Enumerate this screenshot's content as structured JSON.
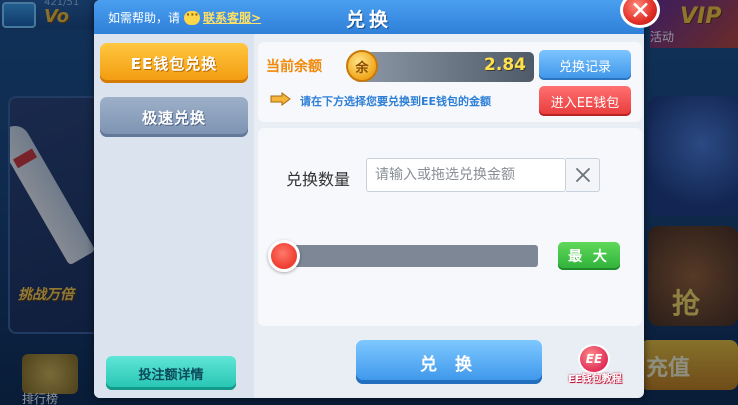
{
  "background": {
    "logo_text": "Vo",
    "user_id": "421/51",
    "left_card_text": "挑战万倍",
    "rank_label": "排行榜",
    "right_top_text": "VIP",
    "activity_label": "活动",
    "right_mid_text": "抢",
    "recharge_label": "充值"
  },
  "dialog": {
    "title": "兑换",
    "help_prefix": "如需帮助，请",
    "help_link": "联系客服>"
  },
  "tabs": [
    {
      "label": "EE钱包兑换",
      "active": true
    },
    {
      "label": "极速兑换",
      "active": false
    }
  ],
  "bet_detail_label": "投注额详情",
  "balance": {
    "label": "当前余额",
    "coin_text": "余",
    "value": "2.84"
  },
  "record_label": "兑换记录",
  "hint_text": "请在下方选择您要兑换到EE钱包的金额",
  "enter_wallet_label": "进入EE钱包",
  "exchange_amount": {
    "label": "兑换数量",
    "placeholder": "请输入或拖选兑换金额",
    "value": ""
  },
  "slider": {
    "fraction": 0
  },
  "max_label": "最 大",
  "exchange_button_label": "兑 换",
  "tutorial": {
    "badge": "EE",
    "label": "EE钱包教程"
  },
  "colors": {
    "header_blue": "#3a8fe4",
    "active_tab": "#f5a91a",
    "balance_label": "#f08a0c",
    "danger": "#e83a3a",
    "confirm_green": "#2fb03a"
  },
  "icons": [
    "chat-icon",
    "close-icon",
    "coin-icon",
    "pointing-hand-icon",
    "clear-icon",
    "ee-wallet-icon"
  ]
}
